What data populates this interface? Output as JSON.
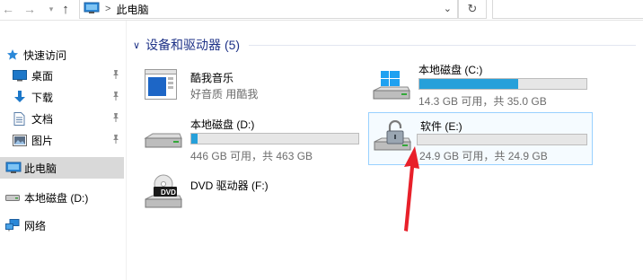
{
  "address": {
    "back_icon": "←",
    "forward_icon": "→",
    "up_icon": "↑",
    "path": "此电脑",
    "separator": ">",
    "dropdown_icon": "⌄",
    "refresh_icon": "↻"
  },
  "sidebar": {
    "items": [
      {
        "label": "快速访问",
        "icon": "star-icon"
      },
      {
        "label": "桌面",
        "icon": "desktop-icon",
        "pinned": true
      },
      {
        "label": "下载",
        "icon": "download-icon",
        "pinned": true
      },
      {
        "label": "文档",
        "icon": "document-icon",
        "pinned": true
      },
      {
        "label": "图片",
        "icon": "pictures-icon",
        "pinned": true
      },
      {
        "label": "此电脑",
        "icon": "this-pc-icon",
        "selected": true
      },
      {
        "label": "本地磁盘 (D:)",
        "icon": "drive-icon"
      },
      {
        "label": "网络",
        "icon": "network-icon"
      }
    ]
  },
  "main": {
    "group": {
      "title": "设备和驱动器 (5)",
      "chevron": "∨"
    },
    "devices": [
      {
        "name": "酷我音乐",
        "sub": "好音质 用酷我",
        "icon": "kuwo-app-icon"
      },
      {
        "name": "本地磁盘 (C:)",
        "sub": "14.3 GB 可用，共 35.0 GB",
        "used_fraction": 0.59,
        "icon": "windows-drive-icon"
      },
      {
        "name": "本地磁盘 (D:)",
        "sub": "446 GB 可用，共 463 GB",
        "used_fraction": 0.037,
        "icon": "drive-icon"
      },
      {
        "name": "软件 (E:)",
        "sub": "24.9 GB 可用，共 24.9 GB",
        "used_fraction": 0.0,
        "icon": "locked-drive-icon"
      },
      {
        "name": "DVD 驱动器 (F:)",
        "sub": "",
        "icon": "dvd-drive-icon",
        "badge": "DVD"
      }
    ]
  },
  "colors": {
    "accent": "#26a0da",
    "header": "#1e3287",
    "annotation": "#e8202a"
  }
}
